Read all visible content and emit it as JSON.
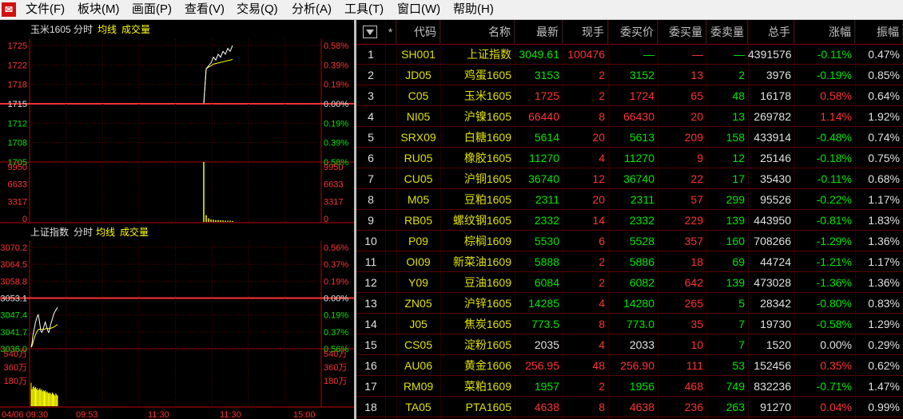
{
  "menu": {
    "app_icon": "logo-icon",
    "items": [
      "文件(F)",
      "板块(M)",
      "画面(P)",
      "查看(V)",
      "交易(Q)",
      "分析(A)",
      "工具(T)",
      "窗口(W)",
      "帮助(H)"
    ]
  },
  "colors": {
    "up": "#ff3232",
    "down": "#00e600",
    "neutral": "#e0e0e0",
    "code": "#e0e000",
    "price_line": "#ffffff",
    "avg_line": "#ffff00",
    "volume": "#ffff00"
  },
  "chart_data": [
    {
      "type": "line",
      "instrument": "玉米1605",
      "title_parts": [
        "玉米1605",
        "分时",
        "均线",
        "成交量"
      ],
      "price_axis": {
        "labels": [
          "1725",
          "1722",
          "1718",
          "1715",
          "1712",
          "1708",
          "1705"
        ],
        "pct_labels": [
          "0.58%",
          "0.39%",
          "0.19%",
          "0.00%",
          "0.19%",
          "0.39%",
          "0.58%"
        ],
        "ylim": [
          1705,
          1725
        ],
        "prev_close": 1715
      },
      "volume_axis": {
        "labels": [
          "9950",
          "6633",
          "3317",
          "0"
        ],
        "ylim": [
          0,
          9950
        ]
      },
      "x": [
        0,
        1,
        2,
        3,
        4,
        5,
        6,
        7,
        8,
        9,
        10,
        11,
        12
      ],
      "price": [
        1715,
        1721,
        1721.5,
        1722,
        1723,
        1722.5,
        1723.5,
        1723,
        1724,
        1723.5,
        1724.5,
        1724,
        1725
      ],
      "avg": [
        1715,
        1721,
        1721.3,
        1721.5,
        1721.8,
        1721.9,
        1722,
        1722.1,
        1722.2,
        1722.3,
        1722.4,
        1722.5,
        1722.6
      ],
      "volume": [
        9950,
        1100,
        600,
        400,
        350,
        300,
        300,
        250,
        250,
        200,
        200,
        200,
        150
      ],
      "total_points": 220
    },
    {
      "type": "line",
      "instrument": "上证指数",
      "title_parts": [
        "上证指数",
        "分时",
        "均线",
        "成交量"
      ],
      "price_axis": {
        "labels": [
          "3070.2",
          "3064.5",
          "3058.8",
          "3053.1",
          "3047.4",
          "3041.7",
          "3036.0"
        ],
        "pct_labels": [
          "0.56%",
          "0.37%",
          "0.19%",
          "0.00%",
          "0.19%",
          "0.37%",
          "0.56%"
        ],
        "ylim": [
          3036.0,
          3070.2
        ],
        "prev_close": 3053.1
      },
      "volume_axis": {
        "labels": [
          "540万",
          "360万",
          "180万"
        ],
        "ylim": [
          0,
          5400000
        ]
      },
      "x_labels": [
        "04/06 09:30",
        "09:53",
        "11:30",
        "11:30",
        "15:00"
      ],
      "x": [
        0,
        1,
        2,
        3,
        4,
        5,
        6,
        7,
        8,
        9,
        10,
        11,
        12,
        13,
        14,
        15,
        16,
        17,
        18,
        19,
        20,
        21,
        22,
        23,
        24,
        25,
        26,
        27,
        28,
        29,
        30
      ],
      "price": [
        3036.5,
        3038,
        3040.5,
        3042,
        3043.5,
        3045,
        3046,
        3047,
        3047.5,
        3046,
        3044,
        3042,
        3041.5,
        3042,
        3043,
        3044,
        3045,
        3044,
        3043,
        3042,
        3041.5,
        3042.5,
        3044,
        3045,
        3046,
        3047,
        3048,
        3048.5,
        3049,
        3049.5,
        3050
      ],
      "avg": [
        3036.5,
        3037,
        3038,
        3039,
        3040,
        3040.8,
        3041.5,
        3042,
        3042.4,
        3042.6,
        3042.6,
        3042.6,
        3042.5,
        3042.5,
        3042.5,
        3042.6,
        3042.7,
        3042.8,
        3042.8,
        3042.8,
        3042.8,
        3042.8,
        3042.9,
        3043,
        3043.1,
        3043.2,
        3043.4,
        3043.6,
        3043.8,
        3044,
        3044.2
      ],
      "volume": [
        2200000,
        1600000,
        1800000,
        1900000,
        1700000,
        1800000,
        1600000,
        1700000,
        1500000,
        1600000,
        1700000,
        1500000,
        1600000,
        1400000,
        1500000,
        1400000,
        1500000,
        1300000,
        1400000,
        1300000,
        1200000,
        1300000,
        1200000,
        1100000,
        1300000,
        1200000,
        1100000,
        1000000,
        1200000,
        1100000,
        1000000
      ],
      "total_points": 240
    }
  ],
  "quote_table": {
    "headers": [
      "▼",
      "*",
      "代码",
      "名称",
      "最新",
      "现手",
      "委买价",
      "委买量",
      "委卖量",
      "总手",
      "涨幅",
      "振幅"
    ],
    "rows": [
      {
        "idx": "1",
        "code": "SH001",
        "name": "上证指数",
        "last": "3049.61",
        "vol": "100476",
        "bid": "—",
        "bidq": "—",
        "askq": "—",
        "total": "4391576",
        "chg": "-0.11%",
        "amp": "0.47%",
        "dir": "down"
      },
      {
        "idx": "2",
        "code": "JD05",
        "name": "鸡蛋1605",
        "last": "3153",
        "vol": "2",
        "bid": "3152",
        "bidq": "13",
        "askq": "2",
        "total": "3976",
        "chg": "-0.19%",
        "amp": "0.85%",
        "dir": "down"
      },
      {
        "idx": "3",
        "code": "C05",
        "name": "玉米1605",
        "last": "1725",
        "vol": "2",
        "bid": "1724",
        "bidq": "65",
        "askq": "48",
        "total": "16178",
        "chg": "0.58%",
        "amp": "0.64%",
        "dir": "up"
      },
      {
        "idx": "4",
        "code": "NI05",
        "name": "沪镍1605",
        "last": "66440",
        "vol": "8",
        "bid": "66430",
        "bidq": "20",
        "askq": "13",
        "total": "269782",
        "chg": "1.14%",
        "amp": "1.92%",
        "dir": "up"
      },
      {
        "idx": "5",
        "code": "SRX09",
        "name": "白糖1609",
        "last": "5614",
        "vol": "20",
        "bid": "5613",
        "bidq": "209",
        "askq": "158",
        "total": "433914",
        "chg": "-0.48%",
        "amp": "0.74%",
        "dir": "down"
      },
      {
        "idx": "6",
        "code": "RU05",
        "name": "橡胶1605",
        "last": "11270",
        "vol": "4",
        "bid": "11270",
        "bidq": "9",
        "askq": "12",
        "total": "25146",
        "chg": "-0.18%",
        "amp": "0.75%",
        "dir": "down"
      },
      {
        "idx": "7",
        "code": "CU05",
        "name": "沪铜1605",
        "last": "36740",
        "vol": "12",
        "bid": "36740",
        "bidq": "22",
        "askq": "17",
        "total": "35430",
        "chg": "-0.11%",
        "amp": "0.68%",
        "dir": "down"
      },
      {
        "idx": "8",
        "code": "M05",
        "name": "豆粕1605",
        "last": "2311",
        "vol": "20",
        "bid": "2311",
        "bidq": "57",
        "askq": "299",
        "total": "95526",
        "chg": "-0.22%",
        "amp": "1.17%",
        "dir": "down"
      },
      {
        "idx": "9",
        "code": "RB05",
        "name": "螺纹钢1605",
        "last": "2332",
        "vol": "14",
        "bid": "2332",
        "bidq": "229",
        "askq": "139",
        "total": "443950",
        "chg": "-0.81%",
        "amp": "1.83%",
        "dir": "down"
      },
      {
        "idx": "10",
        "code": "P09",
        "name": "棕榈1609",
        "last": "5530",
        "vol": "6",
        "bid": "5528",
        "bidq": "357",
        "askq": "160",
        "total": "708266",
        "chg": "-1.29%",
        "amp": "1.36%",
        "dir": "down"
      },
      {
        "idx": "11",
        "code": "OI09",
        "name": "新菜油1609",
        "last": "5888",
        "vol": "2",
        "bid": "5886",
        "bidq": "18",
        "askq": "69",
        "total": "44724",
        "chg": "-1.21%",
        "amp": "1.17%",
        "dir": "down"
      },
      {
        "idx": "12",
        "code": "Y09",
        "name": "豆油1609",
        "last": "6084",
        "vol": "2",
        "bid": "6082",
        "bidq": "642",
        "askq": "139",
        "total": "473028",
        "chg": "-1.36%",
        "amp": "1.36%",
        "dir": "down"
      },
      {
        "idx": "13",
        "code": "ZN05",
        "name": "沪锌1605",
        "last": "14285",
        "vol": "4",
        "bid": "14280",
        "bidq": "265",
        "askq": "5",
        "total": "28342",
        "chg": "-0.80%",
        "amp": "0.83%",
        "dir": "down"
      },
      {
        "idx": "14",
        "code": "J05",
        "name": "焦炭1605",
        "last": "773.5",
        "vol": "8",
        "bid": "773.0",
        "bidq": "35",
        "askq": "7",
        "total": "19730",
        "chg": "-0.58%",
        "amp": "1.29%",
        "dir": "down"
      },
      {
        "idx": "15",
        "code": "CS05",
        "name": "淀粉1605",
        "last": "2035",
        "vol": "4",
        "bid": "2033",
        "bidq": "10",
        "askq": "7",
        "total": "1520",
        "chg": "0.00%",
        "amp": "0.29%",
        "dir": "flat"
      },
      {
        "idx": "16",
        "code": "AU06",
        "name": "黄金1606",
        "last": "256.95",
        "vol": "48",
        "bid": "256.90",
        "bidq": "111",
        "askq": "53",
        "total": "152456",
        "chg": "0.35%",
        "amp": "0.62%",
        "dir": "up"
      },
      {
        "idx": "17",
        "code": "RM09",
        "name": "菜粕1609",
        "last": "1957",
        "vol": "2",
        "bid": "1956",
        "bidq": "468",
        "askq": "749",
        "total": "832236",
        "chg": "-0.71%",
        "amp": "1.47%",
        "dir": "down"
      },
      {
        "idx": "18",
        "code": "TA05",
        "name": "PTA1605",
        "last": "4638",
        "vol": "8",
        "bid": "4638",
        "bidq": "236",
        "askq": "263",
        "total": "91270",
        "chg": "0.04%",
        "amp": "0.99%",
        "dir": "up"
      }
    ]
  }
}
